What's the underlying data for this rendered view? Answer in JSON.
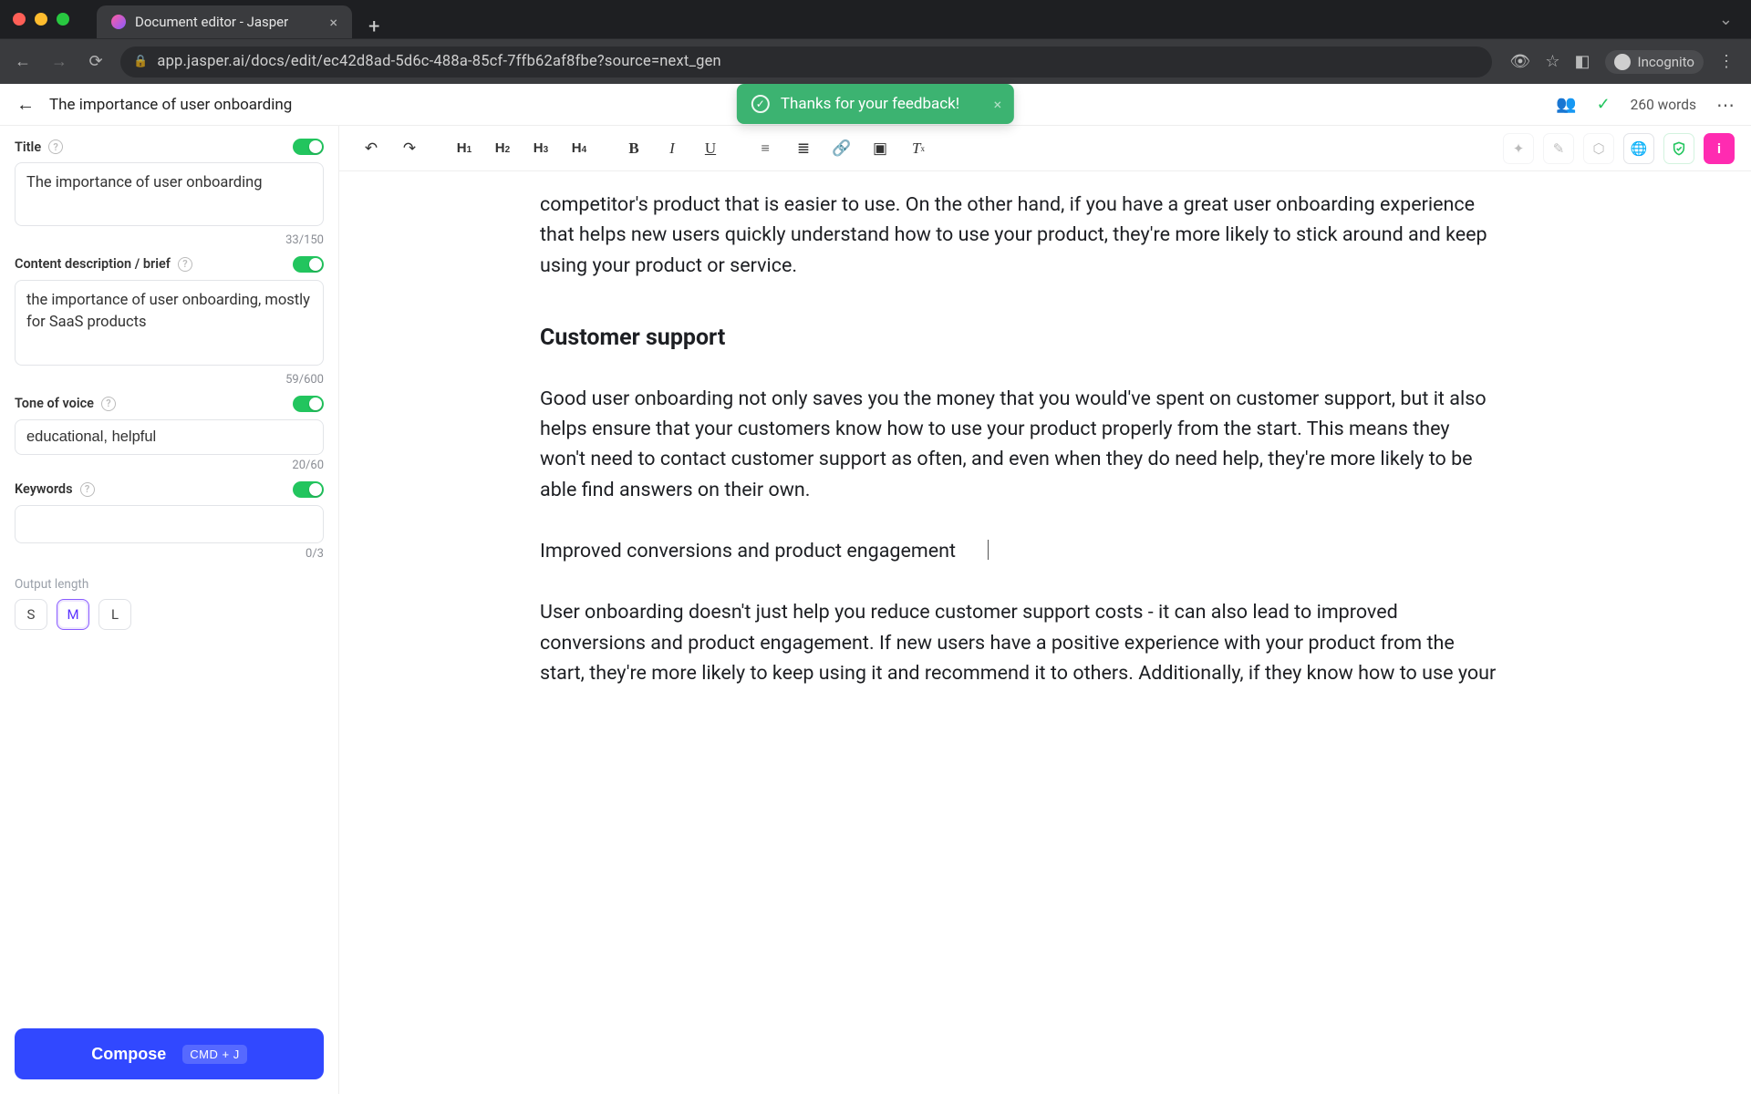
{
  "browser": {
    "tab_title": "Document editor - Jasper",
    "url_display": "app.jasper.ai/docs/edit/ec42d8ad-5d6c-488a-85cf-7ffb62af8fbe?source=next_gen",
    "incognito_label": "Incognito"
  },
  "header": {
    "doc_title": "The importance of user onboarding",
    "word_count": "260 words"
  },
  "toast": {
    "message": "Thanks for your feedback!"
  },
  "sidebar": {
    "title": {
      "label": "Title",
      "value": "The importance of user onboarding",
      "counter": "33/150"
    },
    "brief": {
      "label": "Content description / brief",
      "value": "the importance of user onboarding, mostly for SaaS products",
      "counter": "59/600"
    },
    "tone": {
      "label": "Tone of voice",
      "value": "educational, helpful",
      "counter": "20/60"
    },
    "keywords": {
      "label": "Keywords",
      "value": "",
      "counter": "0/3"
    },
    "output_length": {
      "label": "Output length",
      "options": {
        "s": "S",
        "m": "M",
        "l": "L"
      },
      "selected": "M"
    },
    "compose": {
      "label": "Compose",
      "shortcut": "CMD + J"
    }
  },
  "toolbar": {
    "h1": "H",
    "h2": "H",
    "h3": "H",
    "h4": "H"
  },
  "document": {
    "para_churn": "competitor's product that is easier to use. On the other hand, if you have a great user onboarding experience that helps new users quickly understand how to use your product, they're more likely to stick around and keep using your product or service.",
    "heading_cs": "Customer support",
    "para_cs": "Good user onboarding not only saves you the money that you would've spent on customer support, but it also helps ensure that your customers know how to use your product properly from the start. This means they won't need to contact customer support as often, and even when they do need help, they're more likely to be able find answers on their own.",
    "line_conv": "Improved conversions and product engagement",
    "para_conv": "User onboarding doesn't just help you reduce customer support costs - it can also lead to improved conversions and product engagement. If new users have a positive experience with your product from the start, they're more likely to keep using it and recommend it to others. Additionally, if they know how to use your"
  }
}
